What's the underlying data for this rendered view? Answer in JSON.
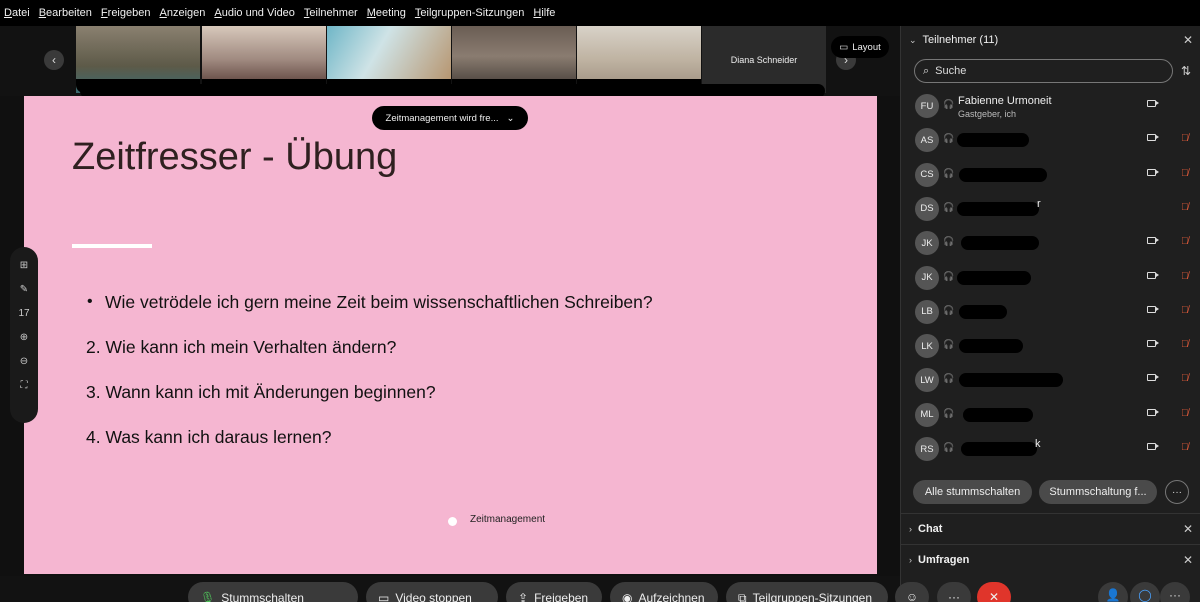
{
  "menu": [
    "Datei",
    "Bearbeiten",
    "Freigeben",
    "Anzeigen",
    "Audio und Video",
    "Teilnehmer",
    "Meeting",
    "Teilgruppen-Sitzungen",
    "Hilfe"
  ],
  "strip": {
    "named_tile": "Diana Schneider",
    "layout_label": "Layout"
  },
  "share_banner": "Zeitmanagement wird fre...",
  "side_tools": {
    "page_number": "17"
  },
  "slide": {
    "title": "Zeitfresser - Übung",
    "bullet_item": "Wie vetrödele ich gern meine Zeit beim wissenschaftlichen Schreiben?",
    "items": [
      "2. Wie kann ich mein Verhalten ändern?",
      "3. Wann kann ich mit Änderungen beginnen?",
      "4. Was kann ich daraus lernen?"
    ],
    "footer": "Zeitmanagement"
  },
  "panel": {
    "title": "Teilnehmer (11)",
    "search_placeholder": "Suche",
    "participants": [
      {
        "initials": "FU",
        "name": "Fabienne Urmoneit",
        "role": "Gastgeber, ich",
        "video": true,
        "muted": false
      },
      {
        "initials": "AS",
        "name": "",
        "video": true,
        "muted": true
      },
      {
        "initials": "CS",
        "name": "",
        "video": true,
        "muted": true
      },
      {
        "initials": "DS",
        "name": "r",
        "video": false,
        "muted": true
      },
      {
        "initials": "JK",
        "name": "",
        "video": true,
        "muted": true
      },
      {
        "initials": "JK",
        "name": "",
        "video": true,
        "muted": true
      },
      {
        "initials": "LB",
        "name": "",
        "video": true,
        "muted": true
      },
      {
        "initials": "LK",
        "name": "",
        "video": true,
        "muted": true
      },
      {
        "initials": "LW",
        "name": "",
        "video": true,
        "muted": true
      },
      {
        "initials": "ML",
        "name": "",
        "video": true,
        "muted": true
      },
      {
        "initials": "RS",
        "name": "k",
        "video": true,
        "muted": true
      }
    ],
    "mute_all": "Alle stummschalten",
    "mute_more": "Stummschaltung f...",
    "chat": "Chat",
    "polls": "Umfragen"
  },
  "bottom": {
    "mute": "Stummschalten",
    "video": "Video stoppen",
    "share": "Freigeben",
    "record": "Aufzeichnen",
    "breakout": "Teilgruppen-Sitzungen"
  },
  "colors": {
    "slide_bg": "#f5b6d1",
    "end_call": "#e0352b",
    "mute_red": "#e05a3a"
  }
}
